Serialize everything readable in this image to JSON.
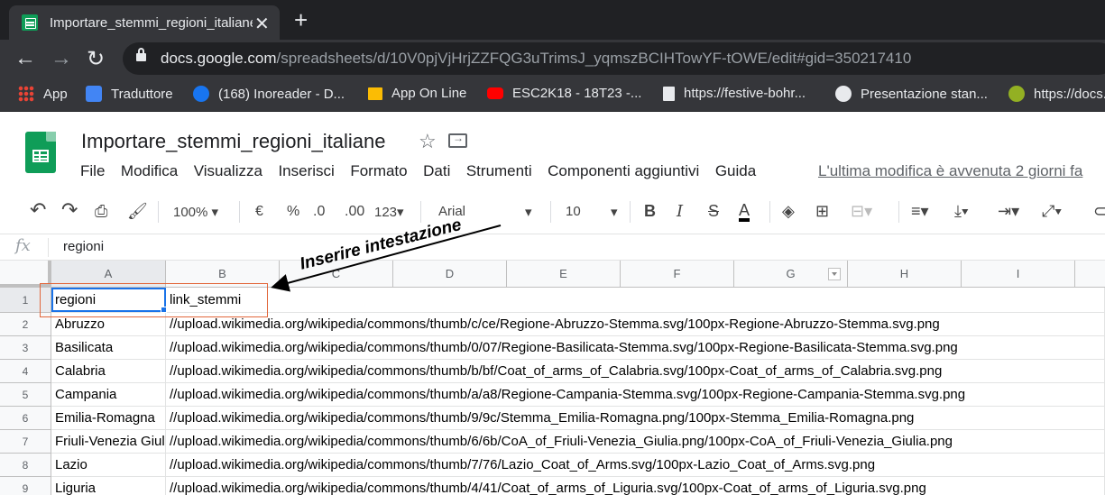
{
  "browser": {
    "tab_title": "Importare_stemmi_regioni_italiane",
    "url_host": "docs.google.com",
    "url_path": "/spreadsheets/d/10V0pjVjHrjZZFQG3uTrimsJ_yqmszBCIHTowYF-tOWE/edit#gid=350217410"
  },
  "bookmarks": [
    {
      "label": "App",
      "icon": "apps-grid-icon"
    },
    {
      "label": "Traduttore",
      "icon": "google-translate-icon"
    },
    {
      "label": "(168) Inoreader - D...",
      "icon": "inoreader-icon"
    },
    {
      "label": "App On Line",
      "icon": "folder-icon"
    },
    {
      "label": "ESC2K18 - 18T23 -...",
      "icon": "youtube-icon"
    },
    {
      "label": "https://festive-bohr...",
      "icon": "page-icon"
    },
    {
      "label": "Presentazione stan...",
      "icon": "globe-icon"
    },
    {
      "label": "https://docs.g",
      "icon": "qgis-icon"
    }
  ],
  "sheets": {
    "title": "Importare_stemmi_regioni_italiane",
    "menu": [
      "File",
      "Modifica",
      "Visualizza",
      "Inserisci",
      "Formato",
      "Dati",
      "Strumenti",
      "Componenti aggiuntivi",
      "Guida"
    ],
    "last_edit": "L'ultima modifica è avvenuta 2 giorni fa"
  },
  "toolbar": {
    "zoom": "100%",
    "currency": "€",
    "percent": "%",
    "decimal_decrease": ".0",
    "decimal_increase": ".00",
    "more_formats": "123",
    "font": "Arial",
    "font_size": "10",
    "bold": "B",
    "italic": "I",
    "strike": "S",
    "text_color": "A"
  },
  "formula_bar": {
    "fx": "fx",
    "value": "regioni"
  },
  "columns": [
    "A",
    "B",
    "C",
    "D",
    "E",
    "F",
    "G",
    "H",
    "I"
  ],
  "rows": [
    {
      "num": "1",
      "a": "regioni",
      "b": "link_stemmi"
    },
    {
      "num": "2",
      "a": "Abruzzo",
      "b": "//upload.wikimedia.org/wikipedia/commons/thumb/c/ce/Regione-Abruzzo-Stemma.svg/100px-Regione-Abruzzo-Stemma.svg.png"
    },
    {
      "num": "3",
      "a": "Basilicata",
      "b": "//upload.wikimedia.org/wikipedia/commons/thumb/0/07/Regione-Basilicata-Stemma.svg/100px-Regione-Basilicata-Stemma.svg.png"
    },
    {
      "num": "4",
      "a": "Calabria",
      "b": "//upload.wikimedia.org/wikipedia/commons/thumb/b/bf/Coat_of_arms_of_Calabria.svg/100px-Coat_of_arms_of_Calabria.svg.png"
    },
    {
      "num": "5",
      "a": "Campania",
      "b": "//upload.wikimedia.org/wikipedia/commons/thumb/a/a8/Regione-Campania-Stemma.svg/100px-Regione-Campania-Stemma.svg.png"
    },
    {
      "num": "6",
      "a": "Emilia-Romagna",
      "b": "//upload.wikimedia.org/wikipedia/commons/thumb/9/9c/Stemma_Emilia-Romagna.png/100px-Stemma_Emilia-Romagna.png"
    },
    {
      "num": "7",
      "a": "Friuli-Venezia Giulia",
      "b": "//upload.wikimedia.org/wikipedia/commons/thumb/6/6b/CoA_of_Friuli-Venezia_Giulia.png/100px-CoA_of_Friuli-Venezia_Giulia.png"
    },
    {
      "num": "8",
      "a": "Lazio",
      "b": "//upload.wikimedia.org/wikipedia/commons/thumb/7/76/Lazio_Coat_of_Arms.svg/100px-Lazio_Coat_of_Arms.svg.png"
    },
    {
      "num": "9",
      "a": "Liguria",
      "b": "//upload.wikimedia.org/wikipedia/commons/thumb/4/41/Coat_of_arms_of_Liguria.svg/100px-Coat_of_arms_of_Liguria.svg.png"
    }
  ],
  "annotation": "Inserire intestazione"
}
